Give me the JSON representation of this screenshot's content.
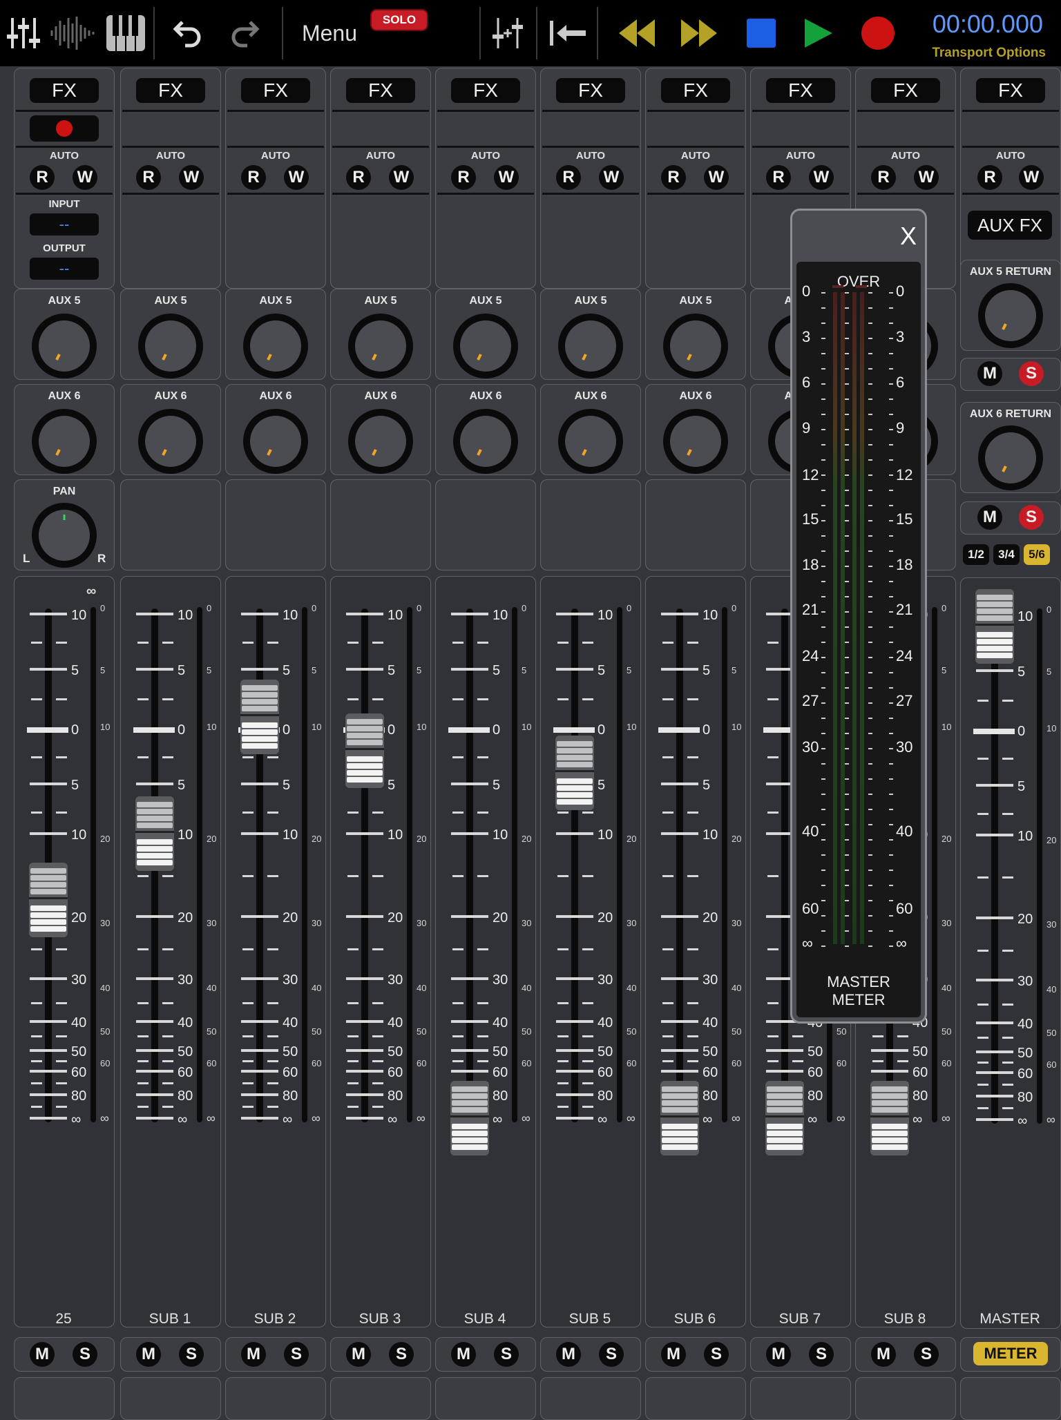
{
  "toolbar": {
    "icons": [
      "mixer-sliders-icon",
      "waveform-icon",
      "piano-keys-icon",
      "undo-icon",
      "redo-icon"
    ],
    "menu_label": "Menu",
    "solo_badge": "SOLO",
    "time": "00:00.000",
    "transport_options": "Transport Options",
    "transport_icons": [
      "fader-insert-icon",
      "return-to-start-icon",
      "rewind-icon",
      "fast-forward-icon",
      "stop-icon",
      "play-icon",
      "record-icon"
    ],
    "colors": {
      "transport_yellow": "#b4a128",
      "stop_blue": "#1d5ee6",
      "play_green": "#14a03a",
      "record_red": "#cc1212",
      "time_blue": "#5d99ff"
    }
  },
  "common": {
    "fx_label": "FX",
    "auto_label": "AUTO",
    "read_label": "R",
    "write_label": "W",
    "aux5_label": "AUX 5",
    "aux6_label": "AUX 6",
    "pan_label": "PAN",
    "pan_left": "L",
    "pan_right": "R",
    "input_label": "INPUT",
    "output_label": "OUTPUT",
    "input_value": "--",
    "output_value": "--",
    "mute_label": "M",
    "solo_label": "S",
    "fader_scale": [
      "10",
      "5",
      "0",
      "5",
      "10",
      "20",
      "30",
      "40",
      "50",
      "60",
      "80",
      "∞"
    ],
    "meter_scale": [
      "0",
      "5",
      "10",
      "20",
      "30",
      "40",
      "50",
      "60",
      "∞"
    ],
    "link_icon": "∞"
  },
  "strips": [
    {
      "name": "25",
      "fader_db": -18
    },
    {
      "name": "SUB 1",
      "fader_db": -10
    },
    {
      "name": "SUB 2",
      "fader_db": 1
    },
    {
      "name": "SUB 3",
      "fader_db": -2
    },
    {
      "name": "SUB 4",
      "fader_db": -90
    },
    {
      "name": "SUB 5",
      "fader_db": -4
    },
    {
      "name": "SUB 6",
      "fader_db": -90
    },
    {
      "name": "SUB 7",
      "fader_db": -90
    },
    {
      "name": "SUB 8",
      "fader_db": -90
    }
  ],
  "master": {
    "name": "MASTER",
    "fader_db": 9,
    "fx_label": "FX",
    "aux_fx_label": "AUX FX",
    "aux5_return_label": "AUX 5 RETURN",
    "aux6_return_label": "AUX 6 RETURN",
    "groups": [
      "1/2",
      "3/4",
      "5/6"
    ],
    "meter_button": "METER"
  },
  "master_meter": {
    "close_label": "X",
    "over_label": "OVER",
    "title_line1": "MASTER",
    "title_line2": "METER",
    "scale": [
      "0",
      "3",
      "6",
      "9",
      "12",
      "15",
      "18",
      "21",
      "24",
      "27",
      "30",
      "40",
      "60",
      "∞"
    ]
  }
}
